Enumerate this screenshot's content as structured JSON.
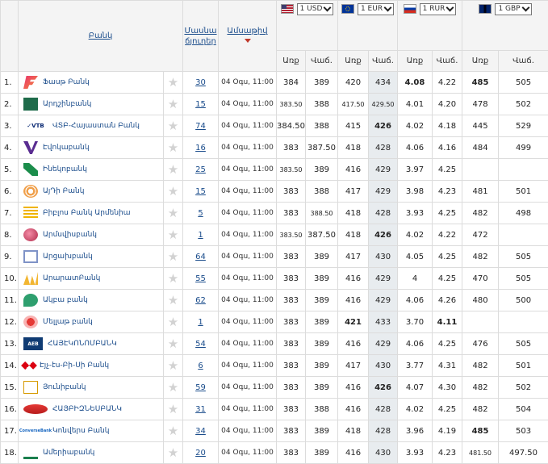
{
  "header": {
    "bank_col": "Բանկ",
    "branches_col_line1": "Մասնա",
    "branches_col_line2": "ճյուղեր",
    "date_col": "Ամսաթիվ",
    "buy": "Առք",
    "sell": "Վաճ.",
    "currencies": [
      {
        "label": "1 USD",
        "code": "usd"
      },
      {
        "label": "1 EUR",
        "code": "eur"
      },
      {
        "label": "1 RUR",
        "code": "rur"
      },
      {
        "label": "1 GBP",
        "code": "gbp"
      }
    ]
  },
  "rows": [
    {
      "n": "1.",
      "bank": "Ֆասթ Բանկ",
      "logo": "fast",
      "branches": "30",
      "date": "04 Օգս, 11:00",
      "usd_b": "384",
      "usd_s": "389",
      "eur_b": "420",
      "eur_s": "434",
      "rur_b": "4.08",
      "rur_s": "4.22",
      "gbp_b": "485",
      "gbp_s": "505",
      "bold": [
        "rur_b",
        "gbp_b"
      ]
    },
    {
      "n": "2.",
      "bank": "Արդշինբանկ",
      "logo": "ardshin",
      "branches": "15",
      "date": "04 Օգս, 11:00",
      "usd_b": "383.50",
      "usd_s": "388",
      "eur_b": "417.50",
      "eur_s": "429.50",
      "rur_b": "4.01",
      "rur_s": "4.20",
      "gbp_b": "478",
      "gbp_s": "502",
      "small": [
        "usd_b",
        "eur_b",
        "eur_s"
      ]
    },
    {
      "n": "3.",
      "bank": "ՎՏԲ-Հայաստան Բանկ",
      "logo": "vtb",
      "branches": "74",
      "date": "04 Օգս, 11:00",
      "usd_b": "384.50",
      "usd_s": "388",
      "eur_b": "415",
      "eur_s": "426",
      "rur_b": "4.02",
      "rur_s": "4.18",
      "gbp_b": "445",
      "gbp_s": "529",
      "bold": [
        "eur_s"
      ]
    },
    {
      "n": "4.",
      "bank": "Էվոկաբանկ",
      "logo": "evoca",
      "branches": "16",
      "date": "04 Օգս, 11:00",
      "usd_b": "383",
      "usd_s": "387.50",
      "eur_b": "418",
      "eur_s": "428",
      "rur_b": "4.06",
      "rur_s": "4.16",
      "gbp_b": "484",
      "gbp_s": "499"
    },
    {
      "n": "5.",
      "bank": "Ինեկոբանկ",
      "logo": "ineco",
      "branches": "25",
      "date": "04 Օգս, 11:00",
      "usd_b": "383.50",
      "usd_s": "389",
      "eur_b": "416",
      "eur_s": "429",
      "rur_b": "3.97",
      "rur_s": "4.25",
      "gbp_b": "",
      "gbp_s": "",
      "small": [
        "usd_b"
      ]
    },
    {
      "n": "6.",
      "bank": "ԱյԴի Բանկ",
      "logo": "idbank",
      "branches": "15",
      "date": "04 Օգս, 11:00",
      "usd_b": "383",
      "usd_s": "388",
      "eur_b": "417",
      "eur_s": "429",
      "rur_b": "3.98",
      "rur_s": "4.23",
      "gbp_b": "481",
      "gbp_s": "501"
    },
    {
      "n": "7.",
      "bank": "Բիբլոս Բանկ Արմենիա",
      "logo": "byblos",
      "branches": "5",
      "date": "04 Օգս, 11:00",
      "usd_b": "383",
      "usd_s": "388.50",
      "eur_b": "418",
      "eur_s": "428",
      "rur_b": "3.93",
      "rur_s": "4.25",
      "gbp_b": "482",
      "gbp_s": "498",
      "small": [
        "usd_s"
      ]
    },
    {
      "n": "8.",
      "bank": "Արմսվիսբանկ",
      "logo": "armswiss",
      "branches": "1",
      "date": "04 Օգս, 11:00",
      "usd_b": "383.50",
      "usd_s": "387.50",
      "eur_b": "418",
      "eur_s": "426",
      "rur_b": "4.02",
      "rur_s": "4.22",
      "gbp_b": "472",
      "gbp_s": "",
      "bold": [
        "eur_s"
      ],
      "small": [
        "usd_b"
      ]
    },
    {
      "n": "9.",
      "bank": "Արցախբանկ",
      "logo": "artsakh",
      "branches": "64",
      "date": "04 Օգս, 11:00",
      "usd_b": "383",
      "usd_s": "389",
      "eur_b": "417",
      "eur_s": "430",
      "rur_b": "4.05",
      "rur_s": "4.25",
      "gbp_b": "482",
      "gbp_s": "505"
    },
    {
      "n": "10.",
      "bank": "ԱրարատԲանկ",
      "logo": "ararat",
      "branches": "55",
      "date": "04 Օգս, 11:00",
      "usd_b": "383",
      "usd_s": "389",
      "eur_b": "416",
      "eur_s": "429",
      "rur_b": "4",
      "rur_s": "4.25",
      "gbp_b": "470",
      "gbp_s": "505"
    },
    {
      "n": "11.",
      "bank": "Ակբա բանկ",
      "logo": "acba",
      "branches": "62",
      "date": "04 Օգս, 11:00",
      "usd_b": "383",
      "usd_s": "389",
      "eur_b": "416",
      "eur_s": "429",
      "rur_b": "4.06",
      "rur_s": "4.26",
      "gbp_b": "480",
      "gbp_s": "500"
    },
    {
      "n": "12.",
      "bank": "Մելլաթ բանկ",
      "logo": "mellat",
      "branches": "1",
      "date": "04 Օգս, 11:00",
      "usd_b": "383",
      "usd_s": "389",
      "eur_b": "421",
      "eur_s": "433",
      "rur_b": "3.70",
      "rur_s": "4.11",
      "gbp_b": "",
      "gbp_s": "",
      "bold": [
        "eur_b",
        "rur_s"
      ]
    },
    {
      "n": "13.",
      "bank": "ՀԱՅԷԿՈՆՈՄԲԱՆԿ",
      "logo": "aeb",
      "branches": "54",
      "date": "04 Օգս, 11:00",
      "usd_b": "383",
      "usd_s": "389",
      "eur_b": "416",
      "eur_s": "429",
      "rur_b": "4.06",
      "rur_s": "4.25",
      "gbp_b": "476",
      "gbp_s": "505"
    },
    {
      "n": "14.",
      "bank": "Էյչ-էս-Բի-Սի Բանկ",
      "logo": "hsbc",
      "branches": "6",
      "date": "04 Օգս, 11:00",
      "usd_b": "383",
      "usd_s": "389",
      "eur_b": "417",
      "eur_s": "430",
      "rur_b": "3.77",
      "rur_s": "4.31",
      "gbp_b": "482",
      "gbp_s": "501"
    },
    {
      "n": "15.",
      "bank": "Յունիբանկ",
      "logo": "uni",
      "branches": "59",
      "date": "04 Օգս, 11:00",
      "usd_b": "383",
      "usd_s": "389",
      "eur_b": "416",
      "eur_s": "426",
      "rur_b": "4.07",
      "rur_s": "4.30",
      "gbp_b": "482",
      "gbp_s": "502",
      "bold": [
        "eur_s"
      ]
    },
    {
      "n": "16.",
      "bank": "ՀԱՅԲԻԶՆԵՍԲԱՆԿ",
      "logo": "abb",
      "branches": "31",
      "date": "04 Օգս, 11:00",
      "usd_b": "383",
      "usd_s": "388",
      "eur_b": "416",
      "eur_s": "428",
      "rur_b": "4.02",
      "rur_s": "4.25",
      "gbp_b": "482",
      "gbp_s": "504"
    },
    {
      "n": "17.",
      "bank": "Կոնվերս Բանկ",
      "logo": "converse",
      "branches": "34",
      "date": "04 Օգս, 11:00",
      "usd_b": "383",
      "usd_s": "389",
      "eur_b": "418",
      "eur_s": "428",
      "rur_b": "3.96",
      "rur_s": "4.19",
      "gbp_b": "485",
      "gbp_s": "503",
      "bold": [
        "gbp_b"
      ]
    },
    {
      "n": "18.",
      "bank": "Ամերիաբանկ",
      "logo": "ameria",
      "branches": "20",
      "date": "04 Օգս, 11:00",
      "usd_b": "383",
      "usd_s": "389",
      "eur_b": "416",
      "eur_s": "430",
      "rur_b": "3.93",
      "rur_s": "4.23",
      "gbp_b": "481.50",
      "gbp_s": "497.50",
      "small": [
        "gbp_b"
      ]
    }
  ]
}
